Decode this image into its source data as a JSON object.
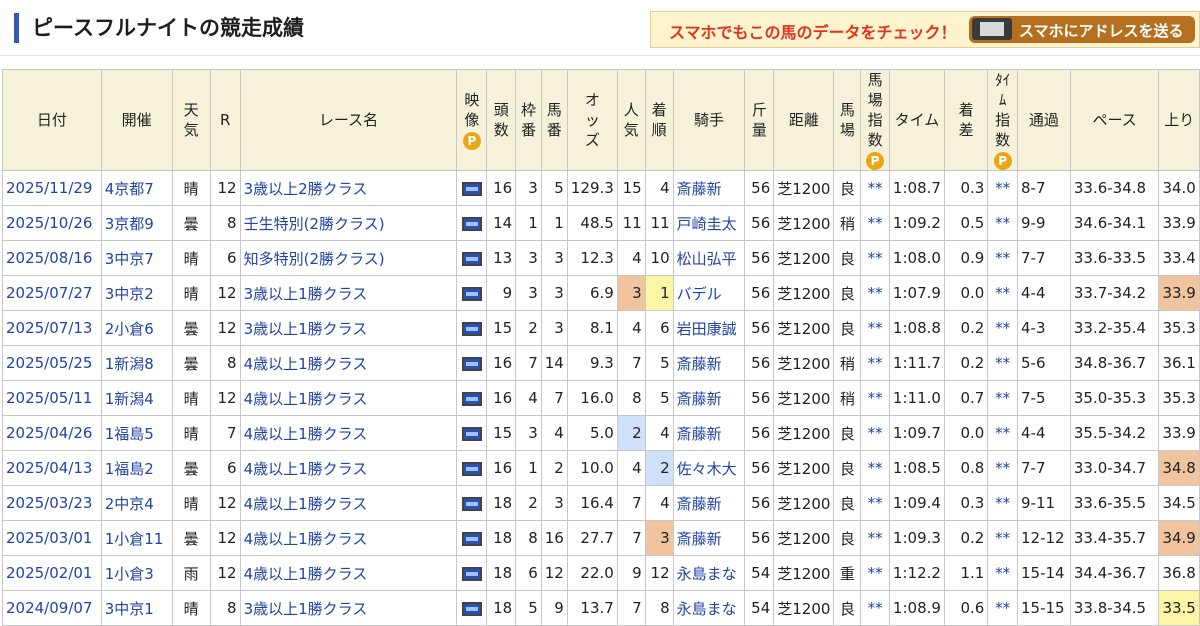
{
  "header": {
    "title": "ピースフルナイトの競走成績",
    "banner_text": "スマホでもこの馬のデータをチェック！",
    "send_button": "スマホにアドレスを送る"
  },
  "table": {
    "headers": {
      "date": "日付",
      "venue": "開催",
      "weather_1": "天",
      "weather_2": "気",
      "r": "R",
      "race": "レース名",
      "video_1": "映",
      "video_2": "像",
      "p_mark": "P",
      "heads_1": "頭",
      "heads_2": "数",
      "frame_1": "枠",
      "frame_2": "番",
      "horse_1": "馬",
      "horse_2": "番",
      "odds_1": "オ",
      "odds_2": "ッ",
      "odds_3": "ズ",
      "pop_1": "人",
      "pop_2": "気",
      "order_1": "着",
      "order_2": "順",
      "jockey": "騎手",
      "weight_1": "斤",
      "weight_2": "量",
      "distance": "距離",
      "track_1": "馬",
      "track_2": "場",
      "tidx_1": "馬",
      "tidx_2": "場",
      "tidx_3": "指",
      "tidx_4": "数",
      "time": "タイム",
      "margin_1": "着",
      "margin_2": "差",
      "timeidx_1": "ﾀｲ",
      "timeidx_2": "ﾑ",
      "timeidx_3": "指",
      "timeidx_4": "数",
      "passing": "通過",
      "pace": "ペース",
      "last": "上り"
    },
    "rows": [
      {
        "date": "2025/11/29",
        "venue": "4京都7",
        "weather": "晴",
        "r": "12",
        "race": "3歳以上2勝クラス",
        "heads": "16",
        "frame": "3",
        "horse": "5",
        "odds": "129.3",
        "pop": "15",
        "order": "4",
        "jockey": "斎藤新",
        "weight": "56",
        "distance": "芝1200",
        "track": "良",
        "tidx": "**",
        "time": "1:08.7",
        "margin": "0.3",
        "timeidx": "**",
        "passing": "8-7",
        "pace": "33.6-34.8",
        "last": "34.0"
      },
      {
        "date": "2025/10/26",
        "venue": "3京都9",
        "weather": "曇",
        "r": "8",
        "race": "壬生特別(2勝クラス)",
        "heads": "14",
        "frame": "1",
        "horse": "1",
        "odds": "48.5",
        "pop": "11",
        "order": "11",
        "jockey": "戸崎圭太",
        "weight": "56",
        "distance": "芝1200",
        "track": "稍",
        "tidx": "**",
        "time": "1:09.2",
        "margin": "0.5",
        "timeidx": "**",
        "passing": "9-9",
        "pace": "34.6-34.1",
        "last": "33.9"
      },
      {
        "date": "2025/08/16",
        "venue": "3中京7",
        "weather": "晴",
        "r": "6",
        "race": "知多特別(2勝クラス)",
        "heads": "13",
        "frame": "3",
        "horse": "3",
        "odds": "12.3",
        "pop": "4",
        "order": "10",
        "jockey": "松山弘平",
        "weight": "56",
        "distance": "芝1200",
        "track": "良",
        "tidx": "**",
        "time": "1:08.0",
        "margin": "0.9",
        "timeidx": "**",
        "passing": "7-7",
        "pace": "33.6-33.5",
        "last": "33.4"
      },
      {
        "date": "2025/07/27",
        "venue": "3中京2",
        "weather": "晴",
        "r": "12",
        "race": "3歳以上1勝クラス",
        "heads": "9",
        "frame": "3",
        "horse": "3",
        "odds": "6.9",
        "pop": "3",
        "order": "1",
        "jockey": "バデル",
        "weight": "56",
        "distance": "芝1200",
        "track": "良",
        "tidx": "**",
        "time": "1:07.9",
        "margin": "0.0",
        "timeidx": "**",
        "passing": "4-4",
        "pace": "33.7-34.2",
        "last": "33.9"
      },
      {
        "date": "2025/07/13",
        "venue": "2小倉6",
        "weather": "曇",
        "r": "12",
        "race": "3歳以上1勝クラス",
        "heads": "15",
        "frame": "2",
        "horse": "3",
        "odds": "8.1",
        "pop": "4",
        "order": "6",
        "jockey": "岩田康誠",
        "weight": "56",
        "distance": "芝1200",
        "track": "良",
        "tidx": "**",
        "time": "1:08.8",
        "margin": "0.2",
        "timeidx": "**",
        "passing": "4-3",
        "pace": "33.2-35.4",
        "last": "35.3"
      },
      {
        "date": "2025/05/25",
        "venue": "1新潟8",
        "weather": "曇",
        "r": "8",
        "race": "4歳以上1勝クラス",
        "heads": "16",
        "frame": "7",
        "horse": "14",
        "odds": "9.3",
        "pop": "7",
        "order": "5",
        "jockey": "斎藤新",
        "weight": "56",
        "distance": "芝1200",
        "track": "稍",
        "tidx": "**",
        "time": "1:11.7",
        "margin": "0.2",
        "timeidx": "**",
        "passing": "5-6",
        "pace": "34.8-36.7",
        "last": "36.1"
      },
      {
        "date": "2025/05/11",
        "venue": "1新潟4",
        "weather": "晴",
        "r": "12",
        "race": "4歳以上1勝クラス",
        "heads": "16",
        "frame": "4",
        "horse": "7",
        "odds": "16.0",
        "pop": "8",
        "order": "5",
        "jockey": "斎藤新",
        "weight": "56",
        "distance": "芝1200",
        "track": "稍",
        "tidx": "**",
        "time": "1:11.0",
        "margin": "0.7",
        "timeidx": "**",
        "passing": "7-5",
        "pace": "35.0-35.3",
        "last": "35.3"
      },
      {
        "date": "2025/04/26",
        "venue": "1福島5",
        "weather": "晴",
        "r": "7",
        "race": "4歳以上1勝クラス",
        "heads": "15",
        "frame": "3",
        "horse": "4",
        "odds": "5.0",
        "pop": "2",
        "order": "4",
        "jockey": "斎藤新",
        "weight": "56",
        "distance": "芝1200",
        "track": "良",
        "tidx": "**",
        "time": "1:09.7",
        "margin": "0.0",
        "timeidx": "**",
        "passing": "4-4",
        "pace": "35.5-34.2",
        "last": "33.9"
      },
      {
        "date": "2025/04/13",
        "venue": "1福島2",
        "weather": "曇",
        "r": "6",
        "race": "4歳以上1勝クラス",
        "heads": "16",
        "frame": "1",
        "horse": "2",
        "odds": "10.0",
        "pop": "4",
        "order": "2",
        "jockey": "佐々木大",
        "weight": "56",
        "distance": "芝1200",
        "track": "良",
        "tidx": "**",
        "time": "1:08.5",
        "margin": "0.8",
        "timeidx": "**",
        "passing": "7-7",
        "pace": "33.0-34.7",
        "last": "34.8"
      },
      {
        "date": "2025/03/23",
        "venue": "2中京4",
        "weather": "晴",
        "r": "12",
        "race": "4歳以上1勝クラス",
        "heads": "18",
        "frame": "2",
        "horse": "3",
        "odds": "16.4",
        "pop": "7",
        "order": "4",
        "jockey": "斎藤新",
        "weight": "56",
        "distance": "芝1200",
        "track": "良",
        "tidx": "**",
        "time": "1:09.4",
        "margin": "0.3",
        "timeidx": "**",
        "passing": "9-11",
        "pace": "33.6-35.5",
        "last": "34.5"
      },
      {
        "date": "2025/03/01",
        "venue": "1小倉11",
        "weather": "曇",
        "r": "12",
        "race": "4歳以上1勝クラス",
        "heads": "18",
        "frame": "8",
        "horse": "16",
        "odds": "27.7",
        "pop": "7",
        "order": "3",
        "jockey": "斎藤新",
        "weight": "56",
        "distance": "芝1200",
        "track": "良",
        "tidx": "**",
        "time": "1:09.3",
        "margin": "0.2",
        "timeidx": "**",
        "passing": "12-12",
        "pace": "33.4-35.7",
        "last": "34.9"
      },
      {
        "date": "2025/02/01",
        "venue": "1小倉3",
        "weather": "雨",
        "r": "12",
        "race": "4歳以上1勝クラス",
        "heads": "18",
        "frame": "6",
        "horse": "12",
        "odds": "22.0",
        "pop": "9",
        "order": "12",
        "jockey": "永島まな",
        "weight": "54",
        "distance": "芝1200",
        "track": "重",
        "tidx": "**",
        "time": "1:12.2",
        "margin": "1.1",
        "timeidx": "**",
        "passing": "15-14",
        "pace": "34.4-36.7",
        "last": "36.8"
      },
      {
        "date": "2024/09/07",
        "venue": "3中京1",
        "weather": "晴",
        "r": "8",
        "race": "3歳以上1勝クラス",
        "heads": "18",
        "frame": "5",
        "horse": "9",
        "odds": "13.7",
        "pop": "7",
        "order": "8",
        "jockey": "永島まな",
        "weight": "54",
        "distance": "芝1200",
        "track": "良",
        "tidx": "**",
        "time": "1:08.9",
        "margin": "0.6",
        "timeidx": "**",
        "passing": "15-15",
        "pace": "33.8-34.5",
        "last": "33.5"
      }
    ]
  },
  "colors": {
    "header_bg": "#f6f2da",
    "link": "#2144a8",
    "highlight_1st": "#fdf5a6",
    "highlight_2nd": "#cfe0fb",
    "highlight_3rd": "#f0c49e"
  }
}
